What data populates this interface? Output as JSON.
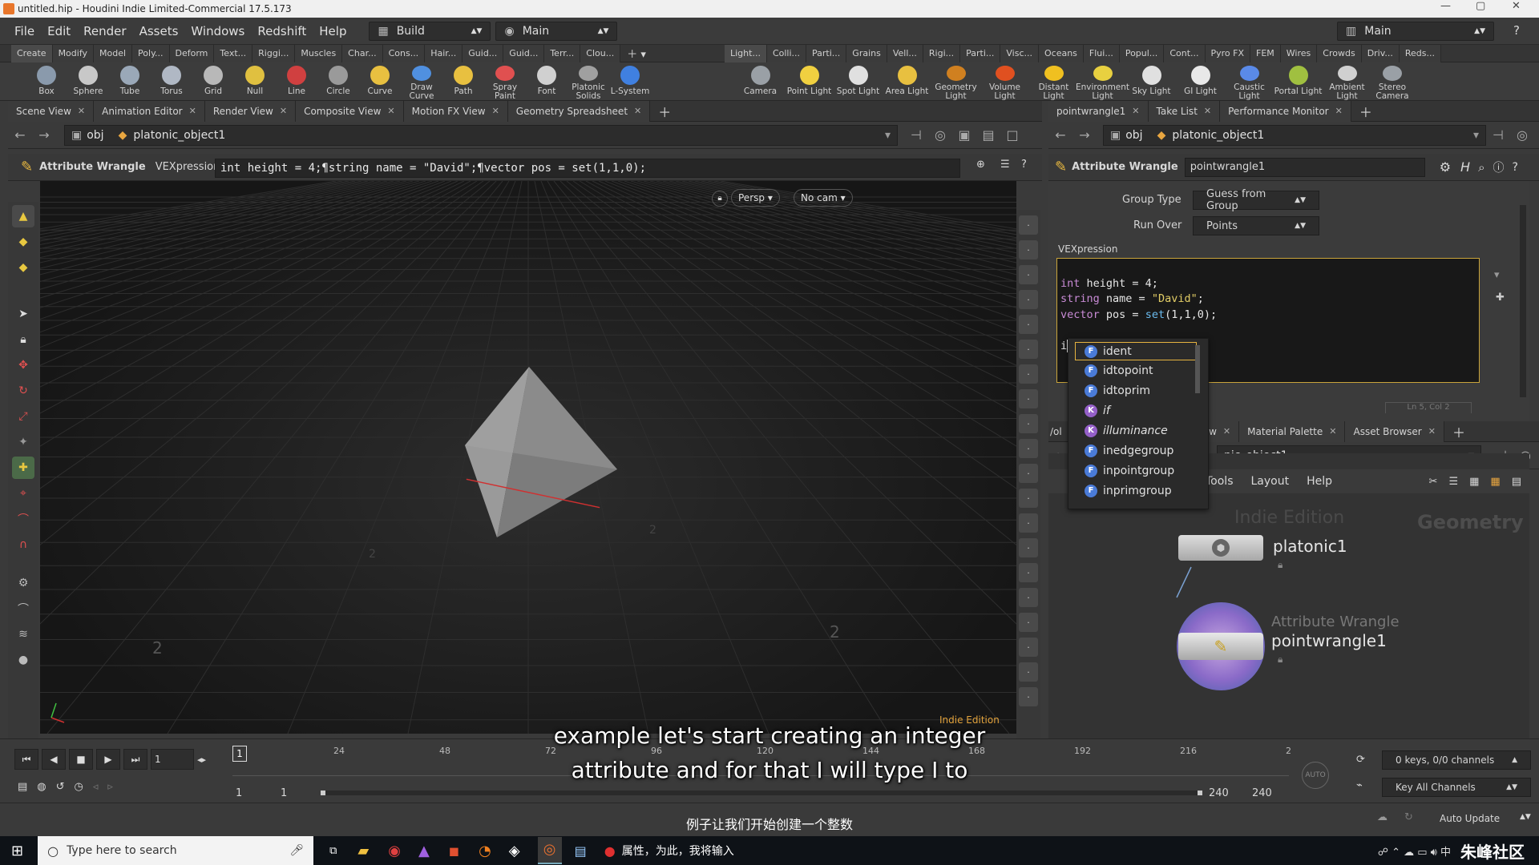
{
  "window": {
    "title": "untitled.hip - Houdini Indie Limited-Commercial 17.5.173"
  },
  "menubar": {
    "items": [
      "File",
      "Edit",
      "Render",
      "Assets",
      "Windows",
      "Redshift",
      "Help"
    ],
    "desktop_left": "Build",
    "desktop_main": "Main",
    "desktop_right": "Main"
  },
  "shelf_tabs_left": [
    "Create",
    "Modify",
    "Model",
    "Poly...",
    "Deform",
    "Text...",
    "Riggi...",
    "Muscles",
    "Char...",
    "Cons...",
    "Hair...",
    "Guid...",
    "Guid...",
    "Terr...",
    "Clou..."
  ],
  "shelf_tabs_right": [
    "Light...",
    "Colli...",
    "Parti...",
    "Grains",
    "Vell...",
    "Rigi...",
    "Parti...",
    "Visc...",
    "Oceans",
    "Flui...",
    "Popul...",
    "Cont...",
    "Pyro FX",
    "FEM",
    "Wires",
    "Crowds",
    "Driv...",
    "Reds..."
  ],
  "shelf_tools_left": [
    {
      "label": "Box",
      "icon": "box-icon"
    },
    {
      "label": "Sphere",
      "icon": "sphere-icon"
    },
    {
      "label": "Tube",
      "icon": "tube-icon"
    },
    {
      "label": "Torus",
      "icon": "torus-icon"
    },
    {
      "label": "Grid",
      "icon": "grid-icon"
    },
    {
      "label": "Null",
      "icon": "null-icon"
    },
    {
      "label": "Line",
      "icon": "line-icon"
    },
    {
      "label": "Circle",
      "icon": "circle-icon"
    },
    {
      "label": "Curve",
      "icon": "curve-icon"
    },
    {
      "label": "Draw Curve",
      "icon": "draw-curve-icon"
    },
    {
      "label": "Path",
      "icon": "path-icon"
    },
    {
      "label": "Spray Paint",
      "icon": "spray-paint-icon"
    },
    {
      "label": "Font",
      "icon": "font-icon"
    },
    {
      "label": "Platonic Solids",
      "icon": "platonic-icon"
    },
    {
      "label": "L-System",
      "icon": "lsystem-icon"
    }
  ],
  "shelf_tools_right": [
    {
      "label": "Camera"
    },
    {
      "label": "Point Light"
    },
    {
      "label": "Spot Light"
    },
    {
      "label": "Area Light"
    },
    {
      "label": "Geometry Light"
    },
    {
      "label": "Volume Light"
    },
    {
      "label": "Distant Light"
    },
    {
      "label": "Environment Light"
    },
    {
      "label": "Sky Light"
    },
    {
      "label": "GI Light"
    },
    {
      "label": "Caustic Light"
    },
    {
      "label": "Portal Light"
    },
    {
      "label": "Ambient Light"
    },
    {
      "label": "Stereo Camera"
    }
  ],
  "left_tabs": [
    "Scene View",
    "Animation Editor",
    "Render View",
    "Composite View",
    "Motion FX View",
    "Geometry Spreadsheet"
  ],
  "right_tabs": [
    "pointwrangle1",
    "Take List",
    "Performance Monitor"
  ],
  "lower_right_tabs": [
    "Material Palette",
    "Asset Browser"
  ],
  "left_path": {
    "context": "obj",
    "node": "platonic_object1"
  },
  "right_path": {
    "context": "obj",
    "node": "platonic_object1"
  },
  "lower_path": {
    "context": "/ob",
    "node": "nic_object1"
  },
  "wrangle_bar": {
    "op_label": "Attribute Wrangle",
    "field_label": "VEXpression",
    "vex_line": "int height = 4;¶string name = \"David\";¶vector pos = set(1,1,0);"
  },
  "viewport": {
    "persp": "Persp",
    "cam": "No cam",
    "watermark": "Indie Edition",
    "ticks": [
      "2",
      "2",
      "2",
      "2"
    ]
  },
  "params": {
    "op_label": "Attribute Wrangle",
    "node_name": "pointwrangle1",
    "group_type_label": "Group Type",
    "group_type_value": "Guess from Group",
    "run_over_label": "Run Over",
    "run_over_value": "Points",
    "vex_label": "VEXpression",
    "code": [
      {
        "kw": "int",
        "rest": " height = 4;"
      },
      {
        "kw": "string",
        "rest": " name = ",
        "str": "\"David\"",
        "tail": ";"
      },
      {
        "kw": "vector",
        "rest": " pos = ",
        "fn": "set",
        "tail": "(1,1,0);"
      }
    ],
    "typed": "i",
    "status": "Ln 5, Col 2"
  },
  "autocomplete": [
    {
      "kind": "F",
      "name": "ident"
    },
    {
      "kind": "F",
      "name": "idtopoint"
    },
    {
      "kind": "F",
      "name": "idtoprim"
    },
    {
      "kind": "K",
      "name": "if"
    },
    {
      "kind": "K",
      "name": "illuminance"
    },
    {
      "kind": "F",
      "name": "inedgegroup"
    },
    {
      "kind": "F",
      "name": "inpointgroup"
    },
    {
      "kind": "F",
      "name": "inprimgroup"
    }
  ],
  "network": {
    "menu": [
      "Tools",
      "Layout",
      "Help"
    ],
    "watermark": "Indie Edition",
    "context_label": "Geometry",
    "node1_name": "platonic1",
    "node2_type": "Attribute Wrangle",
    "node2_name": "pointwrangle1"
  },
  "timeline": {
    "frame": "1",
    "marker": "1",
    "ticks": [
      "24",
      "48",
      "72",
      "96",
      "120",
      "144",
      "168",
      "192",
      "216",
      "2"
    ],
    "range_start": "1",
    "range_start2": "1",
    "range_end": "240",
    "range_end2": "240",
    "keys": "0 keys, 0/0 channels",
    "key_all": "Key All Channels",
    "auto_update": "Auto Update"
  },
  "subtitles": {
    "line1": "example let's start creating an integer",
    "line2": "attribute and for that I will type I to",
    "cn": "例子让我们开始创建一个整数"
  },
  "taskbar": {
    "search": "Type here to search",
    "app_title": "属性，为此，我将输入",
    "brand": "朱峰社区"
  }
}
